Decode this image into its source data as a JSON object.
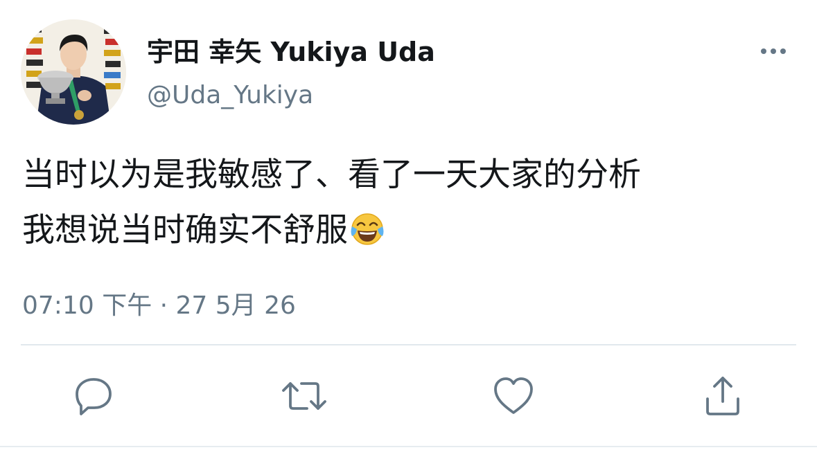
{
  "user": {
    "display_name": "宇田 幸矢 Yukiya Uda",
    "handle": "@Uda_Yukiya"
  },
  "tweet": {
    "lines": [
      "当时以为是我敏感了、看了一天大家的分析",
      "我想说当时确实不舒服"
    ],
    "emoji": "face-with-tears-of-joy",
    "timestamp": "07:10 下午 · 27 5月 26"
  },
  "actions": [
    {
      "name": "reply",
      "icon": "reply-icon"
    },
    {
      "name": "retweet",
      "icon": "retweet-icon"
    },
    {
      "name": "like",
      "icon": "heart-icon"
    },
    {
      "name": "share",
      "icon": "share-icon"
    }
  ],
  "colors": {
    "text": "#14171a",
    "secondary": "#657786",
    "divider": "#e1e8ed"
  }
}
